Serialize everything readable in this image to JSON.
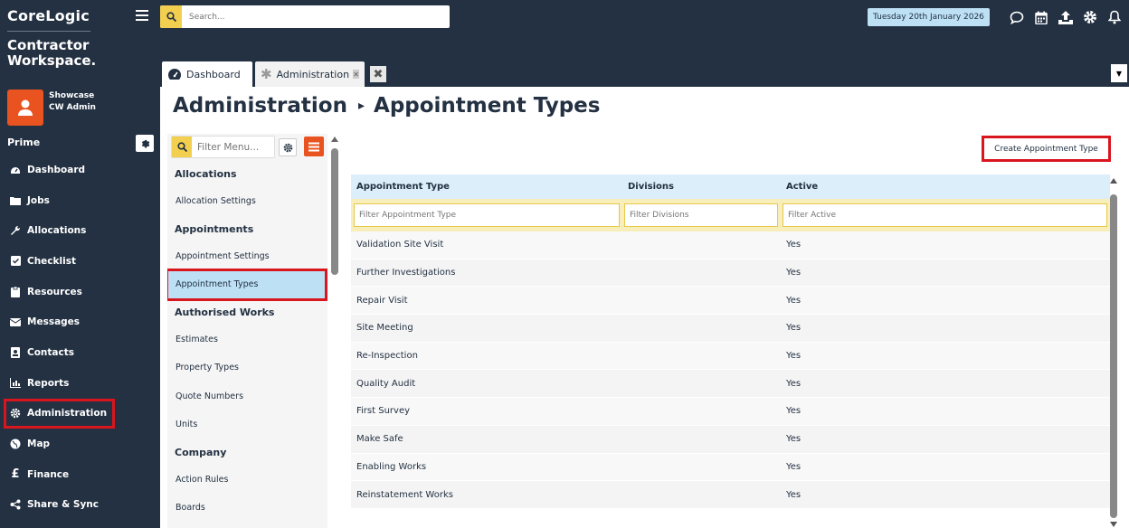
{
  "brand": {
    "logo_text": "CoreLogic",
    "product_line1": "Contractor",
    "product_line2": "Workspace."
  },
  "user": {
    "line1": "Showcase",
    "line2": "CW Admin"
  },
  "sidebar": {
    "section_title": "Prime",
    "items": [
      {
        "label": "Dashboard",
        "icon": "dashboard-icon"
      },
      {
        "label": "Jobs",
        "icon": "folder-icon"
      },
      {
        "label": "Allocations",
        "icon": "wrench-icon"
      },
      {
        "label": "Checklist",
        "icon": "checkbox-icon"
      },
      {
        "label": "Resources",
        "icon": "clipboard-icon"
      },
      {
        "label": "Messages",
        "icon": "envelope-icon"
      },
      {
        "label": "Contacts",
        "icon": "contact-card-icon"
      },
      {
        "label": "Reports",
        "icon": "chart-icon"
      },
      {
        "label": "Administration",
        "icon": "gear-icon"
      },
      {
        "label": "Map",
        "icon": "globe-icon"
      },
      {
        "label": "Finance",
        "icon": "pound-icon"
      },
      {
        "label": "Share & Sync",
        "icon": "share-icon"
      }
    ]
  },
  "topbar": {
    "search_placeholder": "Search...",
    "date": "Tuesday 20th January 2026",
    "icons": [
      "chat-icon",
      "calendar-icon",
      "upload-icon",
      "gear-icon",
      "bell-icon"
    ]
  },
  "tabs": [
    {
      "label": "Dashboard",
      "icon": "speedometer-icon"
    },
    {
      "label": "Administration",
      "icon": "asterisk-icon"
    }
  ],
  "page": {
    "title": "Administration",
    "subtitle": "Appointment Types"
  },
  "admin_menu": {
    "filter_placeholder": "Filter Menu...",
    "groups": [
      {
        "heading": "Allocations",
        "items": [
          "Allocation Settings"
        ]
      },
      {
        "heading": "Appointments",
        "items": [
          "Appointment Settings",
          "Appointment Types"
        ]
      },
      {
        "heading": "Authorised Works",
        "items": [
          "Estimates",
          "Property Types",
          "Quote Numbers",
          "Units"
        ]
      },
      {
        "heading": "Company",
        "items": [
          "Action Rules",
          "Boards"
        ]
      }
    ]
  },
  "create_button": "Create Appointment Type",
  "grid": {
    "columns": [
      "Appointment Type",
      "Divisions",
      "Active"
    ],
    "filters": [
      "Filter Appointment Type",
      "Filter Divisions",
      "Filter Active"
    ],
    "rows": [
      [
        "Validation Site Visit",
        "",
        "Yes"
      ],
      [
        "Further Investigations",
        "",
        "Yes"
      ],
      [
        "Repair Visit",
        "",
        "Yes"
      ],
      [
        "Site Meeting",
        "",
        "Yes"
      ],
      [
        "Re-Inspection",
        "",
        "Yes"
      ],
      [
        "Quality Audit",
        "",
        "Yes"
      ],
      [
        "First Survey",
        "",
        "Yes"
      ],
      [
        "Make Safe",
        "",
        "Yes"
      ],
      [
        "Enabling Works",
        "",
        "Yes"
      ],
      [
        "Reinstatement Works",
        "",
        "Yes"
      ]
    ]
  }
}
